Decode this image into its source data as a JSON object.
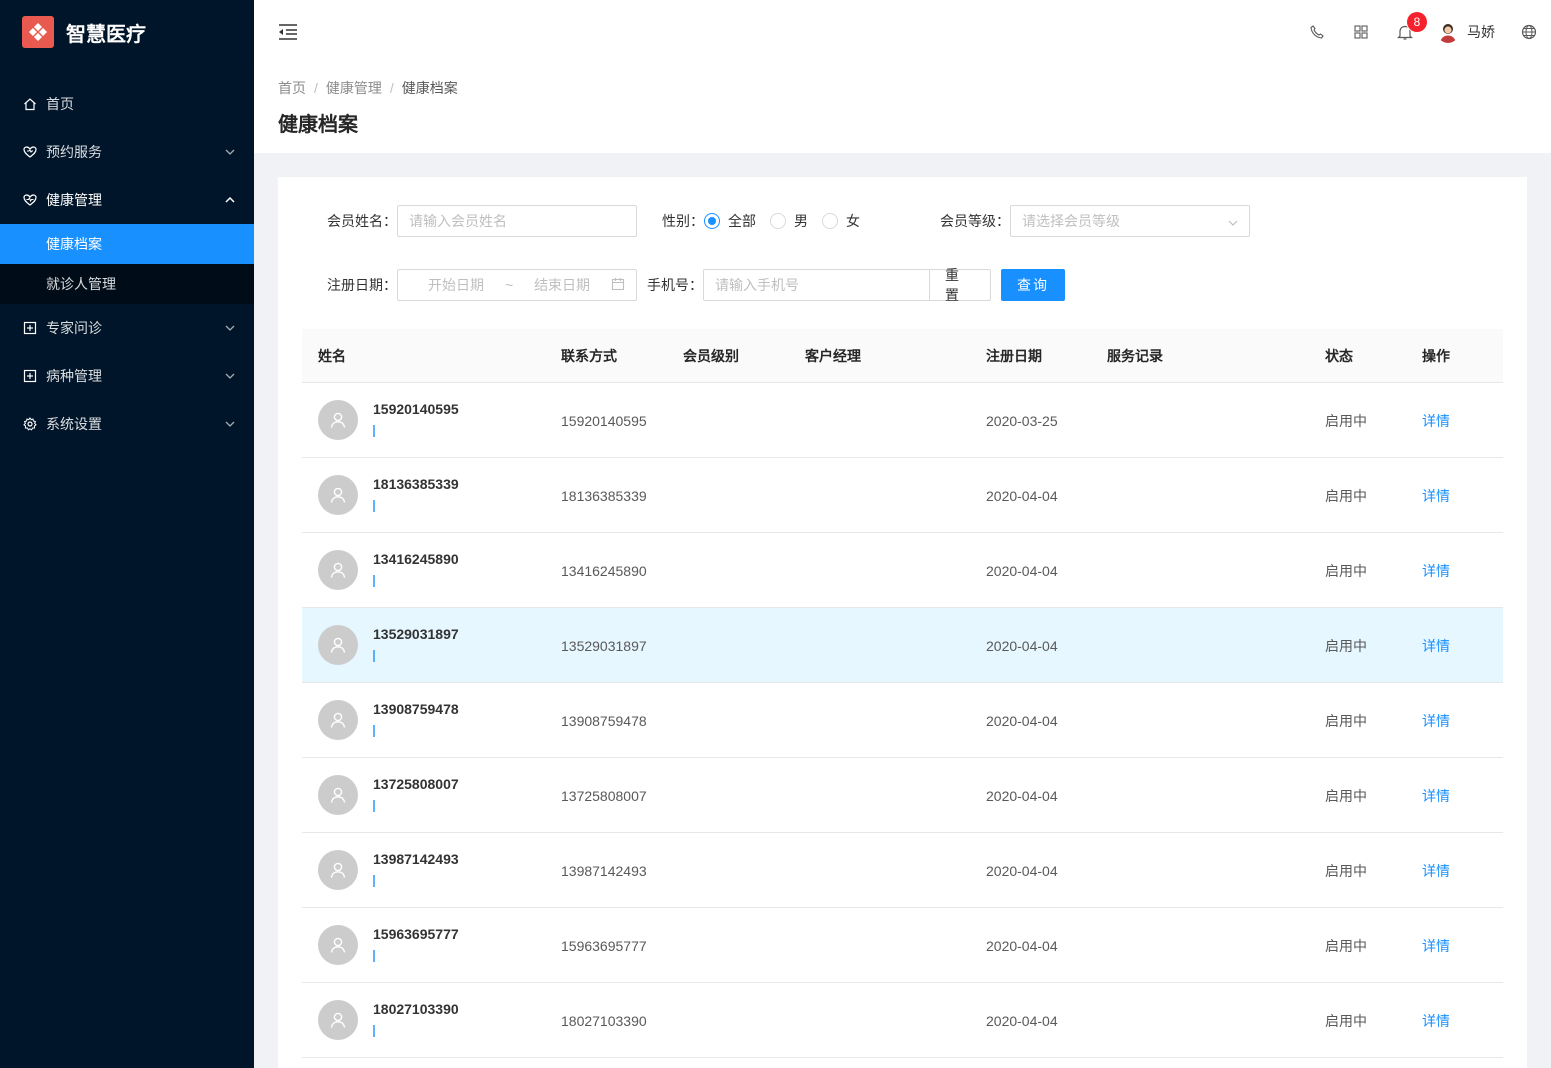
{
  "brand": {
    "title": "智慧医疗"
  },
  "sidebar": {
    "items": [
      {
        "label": "首页"
      },
      {
        "label": "预约服务"
      },
      {
        "label": "健康管理",
        "children": [
          {
            "label": "健康档案"
          },
          {
            "label": "就诊人管理"
          }
        ]
      },
      {
        "label": "专家问诊"
      },
      {
        "label": "病种管理"
      },
      {
        "label": "系统设置"
      }
    ]
  },
  "header": {
    "notification_count": "8",
    "user_name": "马娇"
  },
  "breadcrumb": {
    "items": [
      "首页",
      "健康管理",
      "健康档案"
    ]
  },
  "page": {
    "title": "健康档案"
  },
  "filters": {
    "name_label": "会员姓名：",
    "name_placeholder": "请输入会员姓名",
    "gender_label": "性别：",
    "gender_options": [
      "全部",
      "男",
      "女"
    ],
    "level_label": "会员等级：",
    "level_placeholder": "请选择会员等级",
    "date_label": "注册日期：",
    "date_start_placeholder": "开始日期",
    "date_sep": "~",
    "date_end_placeholder": "结束日期",
    "phone_label": "手机号：",
    "phone_placeholder": "请输入手机号",
    "reset_label": "重置",
    "query_label": "查询"
  },
  "table": {
    "columns": [
      "姓名",
      "联系方式",
      "会员级别",
      "客户经理",
      "注册日期",
      "服务记录",
      "状态",
      "操作"
    ],
    "rows": [
      {
        "name": "15920140595",
        "phone": "15920140595",
        "date": "2020-03-25",
        "status": "启用中",
        "action": "详情"
      },
      {
        "name": "18136385339",
        "phone": "18136385339",
        "date": "2020-04-04",
        "status": "启用中",
        "action": "详情"
      },
      {
        "name": "13416245890",
        "phone": "13416245890",
        "date": "2020-04-04",
        "status": "启用中",
        "action": "详情"
      },
      {
        "name": "13529031897",
        "phone": "13529031897",
        "date": "2020-04-04",
        "status": "启用中",
        "action": "详情"
      },
      {
        "name": "13908759478",
        "phone": "13908759478",
        "date": "2020-04-04",
        "status": "启用中",
        "action": "详情"
      },
      {
        "name": "13725808007",
        "phone": "13725808007",
        "date": "2020-04-04",
        "status": "启用中",
        "action": "详情"
      },
      {
        "name": "13987142493",
        "phone": "13987142493",
        "date": "2020-04-04",
        "status": "启用中",
        "action": "详情"
      },
      {
        "name": "15963695777",
        "phone": "15963695777",
        "date": "2020-04-04",
        "status": "启用中",
        "action": "详情"
      },
      {
        "name": "18027103390",
        "phone": "18027103390",
        "date": "2020-04-04",
        "status": "启用中",
        "action": "详情"
      }
    ]
  }
}
